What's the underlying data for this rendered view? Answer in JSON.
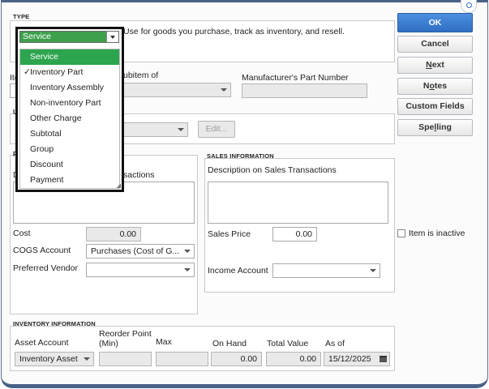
{
  "type_section": {
    "title": "TYPE",
    "selected": "Service",
    "description": "Use for goods you purchase, track as inventory, and resell."
  },
  "type_menu": {
    "items": [
      {
        "label": "Service",
        "state": "highlighted"
      },
      {
        "label": "Inventory Part",
        "state": "checked"
      },
      {
        "label": "Inventory Assembly",
        "state": ""
      },
      {
        "label": "Non-inventory Part",
        "state": ""
      },
      {
        "label": "Other Charge",
        "state": ""
      },
      {
        "label": "Subtotal",
        "state": ""
      },
      {
        "label": "Group",
        "state": ""
      },
      {
        "label": "Discount",
        "state": ""
      },
      {
        "label": "Payment",
        "state": ""
      }
    ]
  },
  "item_row": {
    "item_label_partial": "Ite",
    "subitem_label_partial": "ubitem of",
    "mfr_label": "Manufacturer's Part Number"
  },
  "units": {
    "label_partial": "U",
    "edit_button": "Edit..."
  },
  "purchase": {
    "label_partial": "P",
    "desc_label_partial": "D",
    "desc_label_suffix": "sactions",
    "cost_label": "Cost",
    "cost_value": "0.00",
    "cogs_label": "COGS Account",
    "cogs_value": "Purchases  (Cost of G...",
    "vendor_label": "Preferred Vendor"
  },
  "sales": {
    "title": "SALES INFORMATION",
    "desc_label": "Description on Sales Transactions",
    "price_label": "Sales Price",
    "price_value": "0.00",
    "income_label": "Income Account"
  },
  "inventory": {
    "title": "INVENTORY INFORMATION",
    "asset_label": "Asset Account",
    "asset_value": "Inventory Asset",
    "reorder_label_1": "Reorder Point",
    "reorder_label_2": "(Min)",
    "max_label": "Max",
    "onhand_label": "On Hand",
    "onhand_value": "0.00",
    "total_label": "Total Value",
    "total_value": "0.00",
    "asof_label": "As of",
    "asof_value": "15/12/2025"
  },
  "buttons": {
    "ok": "OK",
    "cancel": "Cancel",
    "next_u": "N",
    "next_rest": "ext",
    "notes_u": "N",
    "notes_mid": "o",
    "notes_u2": "t",
    "notes_rest": "es",
    "custom_fields": "Custom Fields",
    "spelling_pre": "Spe",
    "spelling_u": "l",
    "spelling_rest": "ling"
  },
  "inactive": {
    "label": "Item is inactive",
    "checked": false
  },
  "colors": {
    "accent_blue": "#2f6fc4",
    "menu_highlight": "#2da44e",
    "frame": "#4a6288"
  }
}
